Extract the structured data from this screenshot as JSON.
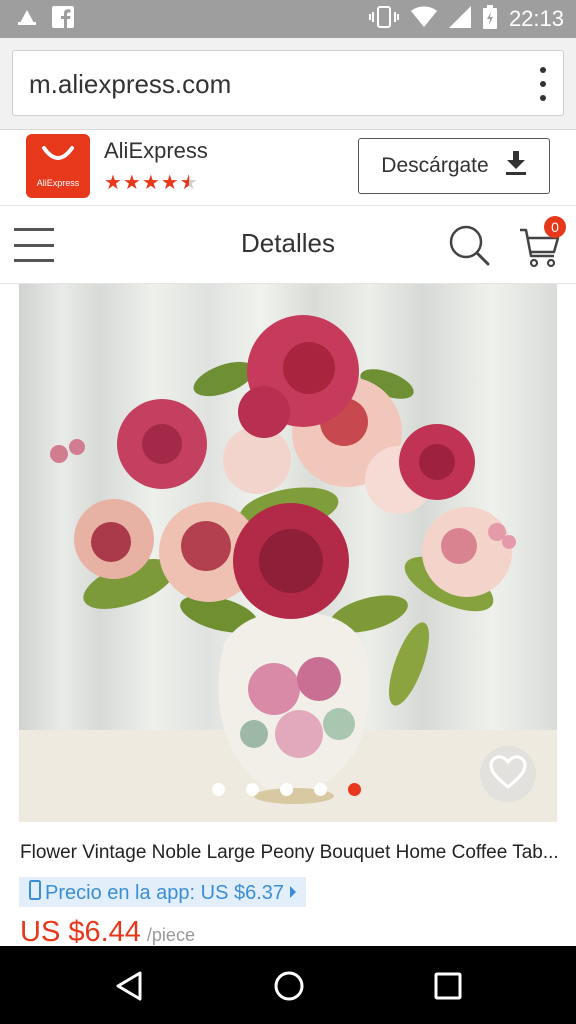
{
  "status_bar": {
    "time": "22:13",
    "icons": [
      "cloud-alert-icon",
      "facebook-icon",
      "vibrate-icon",
      "wifi-icon",
      "signal-icon",
      "battery-icon"
    ]
  },
  "browser": {
    "url": "m.aliexpress.com",
    "menu_icon": "overflow-menu-icon"
  },
  "app_banner": {
    "app_name": "AliExpress",
    "logo_text": "AliExpress",
    "rating_stars": 4.5,
    "download_label": "Descárgate",
    "download_icon": "download-icon"
  },
  "header": {
    "title": "Detalles",
    "cart_count": "0"
  },
  "product": {
    "title": "Flower Vintage Noble Large Peony Bouquet Home Coffee Tab...",
    "app_price_label": "Precio en la app: US $6.37",
    "price": "US $6.44",
    "price_unit": "/piece",
    "carousel_total": 5,
    "carousel_active": 5
  },
  "colors": {
    "accent": "#e8381b",
    "app_price_text": "#3a8ed8",
    "app_price_bg": "#e2eef9"
  }
}
